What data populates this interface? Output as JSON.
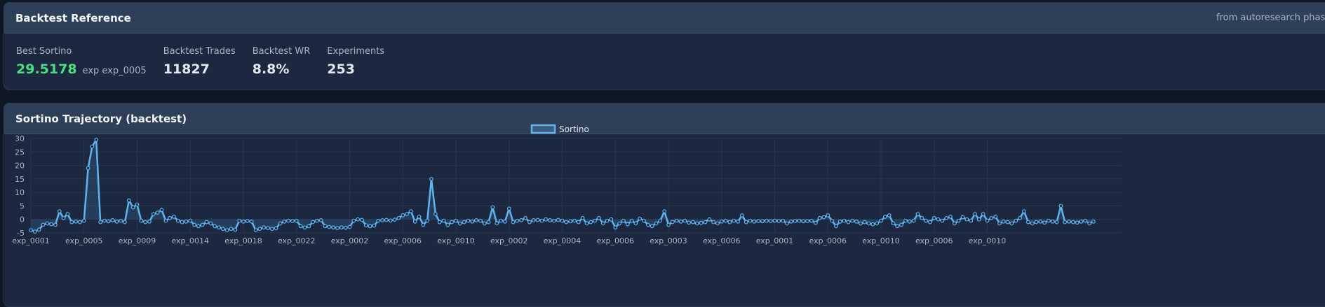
{
  "reference": {
    "title": "Backtest Reference",
    "source_note": "from autoresearch phase",
    "stats": [
      {
        "label": "Best Sortino",
        "value": "29.5178",
        "sub": "exp exp_0005",
        "highlight": true
      },
      {
        "label": "Backtest Trades",
        "value": "11827",
        "sub": "",
        "highlight": false
      },
      {
        "label": "Backtest WR",
        "value": "8.8%",
        "sub": "",
        "highlight": false
      },
      {
        "label": "Experiments",
        "value": "253",
        "sub": "",
        "highlight": false
      }
    ]
  },
  "trajectory": {
    "title": "Sortino Trajectory (backtest)"
  },
  "colors": {
    "line": "#60b4f0",
    "fill": "rgba(96,180,240,0.15)",
    "good": "#4ade80",
    "grid": "#26344d"
  },
  "chart_data": {
    "type": "line",
    "legend": [
      "Sortino"
    ],
    "legend_position": "top-center",
    "grid": true,
    "ylim": [
      -5,
      30
    ],
    "yticks": [
      -5,
      0,
      5,
      10,
      15,
      20,
      25,
      30
    ],
    "xtick_labels": [
      "exp_0001",
      "exp_0005",
      "exp_0009",
      "exp_0014",
      "exp_0018",
      "exp_0022",
      "exp_0002",
      "exp_0006",
      "exp_0010",
      "exp_0002",
      "exp_0004",
      "exp_0006",
      "exp_0003",
      "exp_0006",
      "exp_0001",
      "exp_0006",
      "exp_0010",
      "exp_0006",
      "exp_0010"
    ],
    "xtick_positions": [
      0,
      13,
      26,
      39,
      52,
      65,
      78,
      91,
      104,
      117,
      130,
      143,
      156,
      169,
      182,
      195,
      208,
      221,
      234
    ],
    "series": [
      {
        "name": "Sortino",
        "values": [
          -4,
          -4.5,
          -3.8,
          -2,
          -1.5,
          -1.8,
          -2,
          3,
          0.5,
          2,
          -1,
          -0.8,
          -1,
          -0.5,
          19,
          27,
          29.5,
          -1,
          -0.5,
          -0.7,
          -0.3,
          -0.8,
          -0.5,
          -1,
          7,
          4.5,
          5.5,
          -0.5,
          -1,
          -0.8,
          2,
          2.5,
          3.5,
          -0.5,
          0.5,
          1,
          -0.5,
          -1,
          -0.8,
          -0.5,
          -2,
          -2.5,
          -2,
          -1,
          -1.5,
          -2.5,
          -3,
          -3.5,
          -4,
          -3.5,
          -3.8,
          -0.5,
          -0.8,
          -0.6,
          -0.8,
          -4,
          -3.5,
          -3,
          -3.2,
          -3.5,
          -3.3,
          -1.5,
          -0.8,
          -0.5,
          -0.6,
          -0.5,
          -2.5,
          -3,
          -2.5,
          -1,
          -0.5,
          -0.3,
          -2.5,
          -2.8,
          -3,
          -3.2,
          -3,
          -3.1,
          -2.8,
          -0.5,
          0,
          -0.2,
          -2.2,
          -2.5,
          -2.3,
          -0.5,
          -0.3,
          -0.2,
          -0.4,
          -0.1,
          0.5,
          1.5,
          2,
          3,
          -0.8,
          1,
          -2,
          -0.5,
          15,
          2,
          -1,
          -0.5,
          -2,
          -1,
          -0.5,
          -1.5,
          -1,
          -0.5,
          -0.8,
          -0.3,
          -0.5,
          -1.5,
          -1,
          4.5,
          -1.5,
          -0.5,
          -0.8,
          4,
          -1,
          -0.5,
          -0.3,
          0.5,
          -1,
          -0.3,
          -0.2,
          -0.5,
          0,
          -0.3,
          -0.5,
          -0.2,
          -0.5,
          -1,
          -0.7,
          -0.5,
          -1,
          0.5,
          -1.5,
          -1,
          -0.5,
          0.5,
          -1.5,
          -0.5,
          0,
          -3,
          -1.5,
          -0.5,
          -1.8,
          -0.5,
          -1.5,
          0.3,
          -0.5,
          -2,
          -2.5,
          -1.5,
          -0.5,
          3,
          -2,
          -1,
          -0.5,
          -0.8,
          -0.5,
          -1.2,
          -1,
          -1.5,
          -1.3,
          -1,
          0,
          -1,
          -1.5,
          -0.8,
          -0.5,
          -1,
          -0.5,
          -0.8,
          1.5,
          -1,
          -0.5,
          -0.8,
          -0.6,
          -0.7,
          -0.5,
          -0.6,
          -0.5,
          -0.6,
          -0.5,
          -1.5,
          -0.8,
          -0.6,
          -0.5,
          -0.7,
          -0.6,
          -0.5,
          -1.3,
          0.5,
          0.8,
          1.5,
          -0.5,
          -2.5,
          -0.8,
          -0.5,
          -1,
          -0.5,
          -0.8,
          -1.5,
          -1,
          -1.5,
          -1.8,
          -1.5,
          -0.5,
          1,
          1.5,
          -1.5,
          -2.5,
          -2,
          -0.5,
          -0.8,
          -0.5,
          2,
          0.5,
          -0.5,
          -1,
          0.5,
          0,
          -0.5,
          0.5,
          1,
          -1.5,
          -0.5,
          0.8,
          0,
          -0.5,
          2,
          0,
          2,
          -0.5,
          0.5,
          1,
          -1.5,
          -0.8,
          -1,
          -1.5,
          -0.5,
          0.5,
          3,
          -1,
          -1.5,
          -1,
          -0.8,
          -1.2,
          -0.5,
          -0.8,
          -1,
          5,
          -1,
          -0.8,
          -1,
          -1.2,
          -0.8,
          -0.5,
          -1.5,
          -0.8
        ]
      }
    ]
  }
}
